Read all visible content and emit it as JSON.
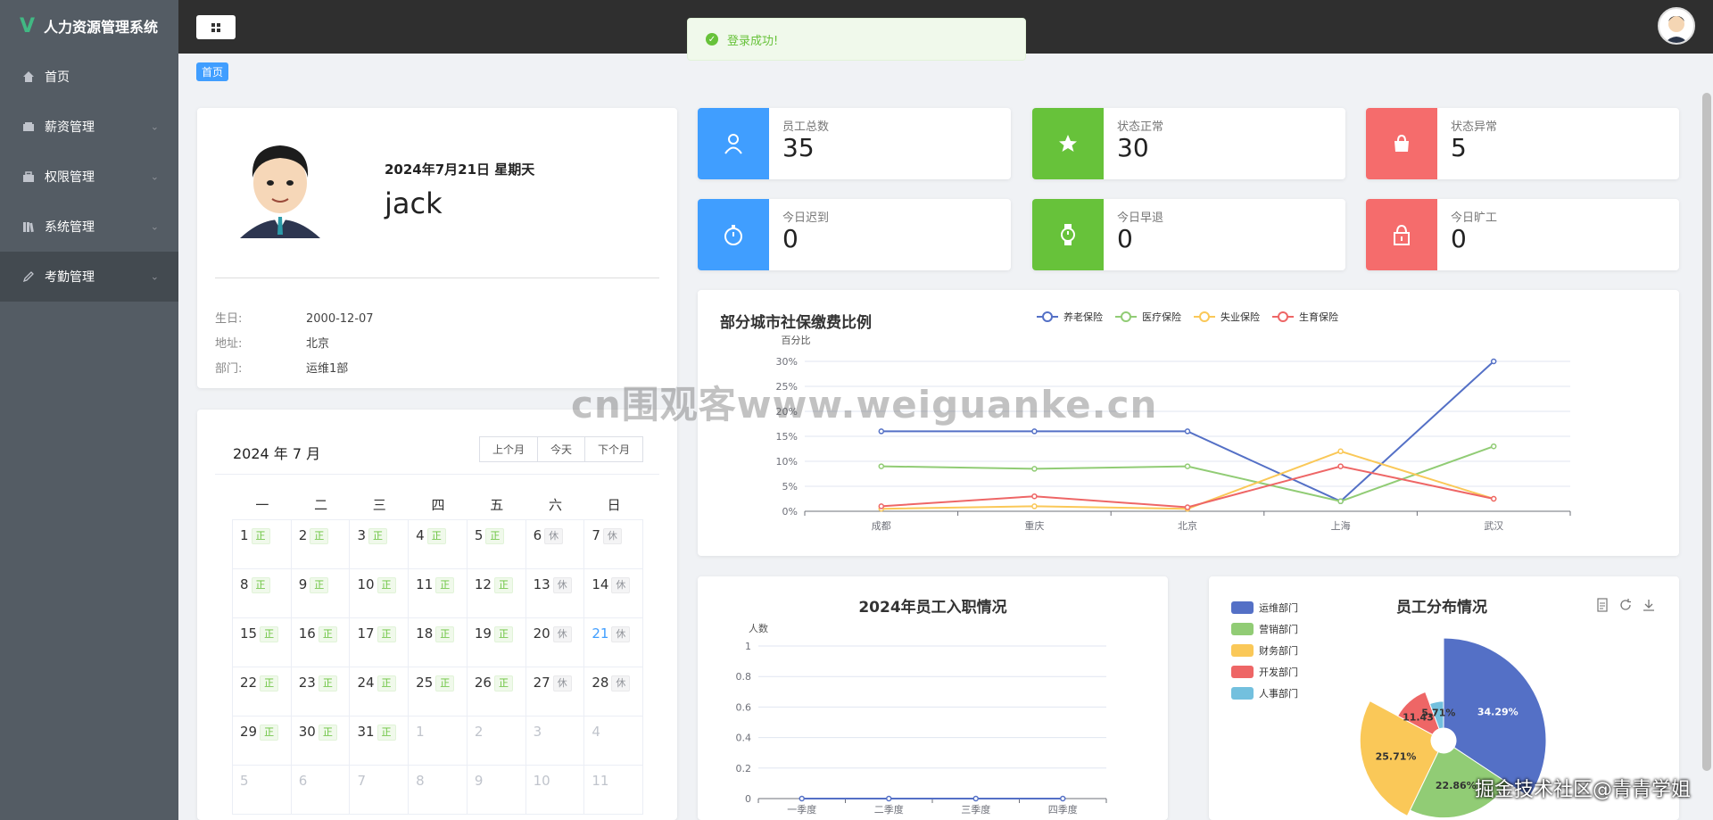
{
  "app": {
    "title": "人力资源管理系统"
  },
  "sidebar": {
    "items": [
      {
        "label": "首页",
        "icon": "home-icon"
      },
      {
        "label": "薪资管理",
        "icon": "wallet-icon"
      },
      {
        "label": "权限管理",
        "icon": "lock-group-icon"
      },
      {
        "label": "系统管理",
        "icon": "books-icon"
      },
      {
        "label": "考勤管理",
        "icon": "pen-icon"
      }
    ]
  },
  "toast": {
    "message": "登录成功!"
  },
  "breadcrumb": {
    "label": "首页"
  },
  "profile": {
    "date": "2024年7月21日 星期天",
    "name": "jack",
    "fields": [
      {
        "label": "生日:",
        "value": "2000-12-07"
      },
      {
        "label": "地址:",
        "value": "北京"
      },
      {
        "label": "部门:",
        "value": "运维1部"
      }
    ]
  },
  "calendar": {
    "title": "2024 年 7 月",
    "buttons": [
      "上个月",
      "今天",
      "下个月"
    ],
    "weekdays": [
      "一",
      "二",
      "三",
      "四",
      "五",
      "六",
      "日"
    ],
    "weeks": [
      [
        {
          "d": "1",
          "t": "正"
        },
        {
          "d": "2",
          "t": "正"
        },
        {
          "d": "3",
          "t": "正"
        },
        {
          "d": "4",
          "t": "正"
        },
        {
          "d": "5",
          "t": "正"
        },
        {
          "d": "6",
          "t": "休"
        },
        {
          "d": "7",
          "t": "休"
        }
      ],
      [
        {
          "d": "8",
          "t": "正"
        },
        {
          "d": "9",
          "t": "正"
        },
        {
          "d": "10",
          "t": "正"
        },
        {
          "d": "11",
          "t": "正"
        },
        {
          "d": "12",
          "t": "正"
        },
        {
          "d": "13",
          "t": "休"
        },
        {
          "d": "14",
          "t": "休"
        }
      ],
      [
        {
          "d": "15",
          "t": "正"
        },
        {
          "d": "16",
          "t": "正"
        },
        {
          "d": "17",
          "t": "正"
        },
        {
          "d": "18",
          "t": "正"
        },
        {
          "d": "19",
          "t": "正"
        },
        {
          "d": "20",
          "t": "休"
        },
        {
          "d": "21",
          "t": "休",
          "today": true
        }
      ],
      [
        {
          "d": "22",
          "t": "正"
        },
        {
          "d": "23",
          "t": "正"
        },
        {
          "d": "24",
          "t": "正"
        },
        {
          "d": "25",
          "t": "正"
        },
        {
          "d": "26",
          "t": "正"
        },
        {
          "d": "27",
          "t": "休"
        },
        {
          "d": "28",
          "t": "休"
        }
      ],
      [
        {
          "d": "29",
          "t": "正"
        },
        {
          "d": "30",
          "t": "正"
        },
        {
          "d": "31",
          "t": "正"
        },
        {
          "d": "1",
          "other": true
        },
        {
          "d": "2",
          "other": true
        },
        {
          "d": "3",
          "other": true
        },
        {
          "d": "4",
          "other": true
        }
      ],
      [
        {
          "d": "5",
          "other": true
        },
        {
          "d": "6",
          "other": true
        },
        {
          "d": "7",
          "other": true
        },
        {
          "d": "8",
          "other": true
        },
        {
          "d": "9",
          "other": true
        },
        {
          "d": "10",
          "other": true
        },
        {
          "d": "11",
          "other": true
        }
      ]
    ]
  },
  "stats": [
    {
      "label": "员工总数",
      "value": "35",
      "color": "#409eff",
      "icon": "user-icon"
    },
    {
      "label": "状态正常",
      "value": "30",
      "color": "#67c23a",
      "icon": "star-icon"
    },
    {
      "label": "状态异常",
      "value": "5",
      "color": "#f56c6c",
      "icon": "bag-icon"
    },
    {
      "label": "今日迟到",
      "value": "0",
      "color": "#409eff",
      "icon": "stopwatch-icon"
    },
    {
      "label": "今日早退",
      "value": "0",
      "color": "#67c23a",
      "icon": "watch-icon"
    },
    {
      "label": "今日旷工",
      "value": "0",
      "color": "#f56c6c",
      "icon": "lock-icon"
    }
  ],
  "watermark": "cn围观客www.weiguanke.cn",
  "corner_mark": "掘金技术社区@青青学姐",
  "chart_data": [
    {
      "type": "line",
      "title": "部分城市社保缴费比例",
      "ylabel": "百分比",
      "categories": [
        "成都",
        "重庆",
        "北京",
        "上海",
        "武汉"
      ],
      "yticks": [
        "0%",
        "5%",
        "10%",
        "15%",
        "20%",
        "25%",
        "30%"
      ],
      "ylim": [
        0,
        30
      ],
      "legend_position": "top",
      "series": [
        {
          "name": "养老保险",
          "color": "#5470c6",
          "values": [
            16,
            16,
            16,
            2,
            30
          ]
        },
        {
          "name": "医疗保险",
          "color": "#91cc75",
          "values": [
            9,
            8.5,
            9,
            2,
            13
          ]
        },
        {
          "name": "失业保险",
          "color": "#fac858",
          "values": [
            0.5,
            1,
            0.5,
            12,
            2.5
          ]
        },
        {
          "name": "生育保险",
          "color": "#ee6666",
          "values": [
            1,
            3,
            0.8,
            9,
            2.5
          ]
        }
      ]
    },
    {
      "type": "line",
      "title": "2024年员工入职情况",
      "ylabel": "人数",
      "categories": [
        "一季度",
        "二季度",
        "三季度",
        "四季度"
      ],
      "yticks": [
        "0",
        "0.2",
        "0.4",
        "0.6",
        "0.8",
        "1"
      ],
      "ylim": [
        0,
        1
      ],
      "series": [
        {
          "color": "#5470c6",
          "values": [
            0,
            0,
            0,
            0
          ]
        }
      ]
    },
    {
      "type": "pie",
      "title": "员工分布情况",
      "legend_position": "left",
      "slices": [
        {
          "name": "运维部门",
          "color": "#5470c6",
          "value": 34.29,
          "label": "34.29%"
        },
        {
          "name": "营销部门",
          "color": "#91cc75",
          "value": 22.86,
          "label": "22.86%"
        },
        {
          "name": "财务部门",
          "color": "#fac858",
          "value": 25.71,
          "label": "25.71%"
        },
        {
          "name": "开发部门",
          "color": "#ee6666",
          "value": 11.43,
          "label": "11.43%"
        },
        {
          "name": "人事部门",
          "color": "#73c0de",
          "value": 5.71,
          "label": "5.71%"
        }
      ]
    }
  ]
}
